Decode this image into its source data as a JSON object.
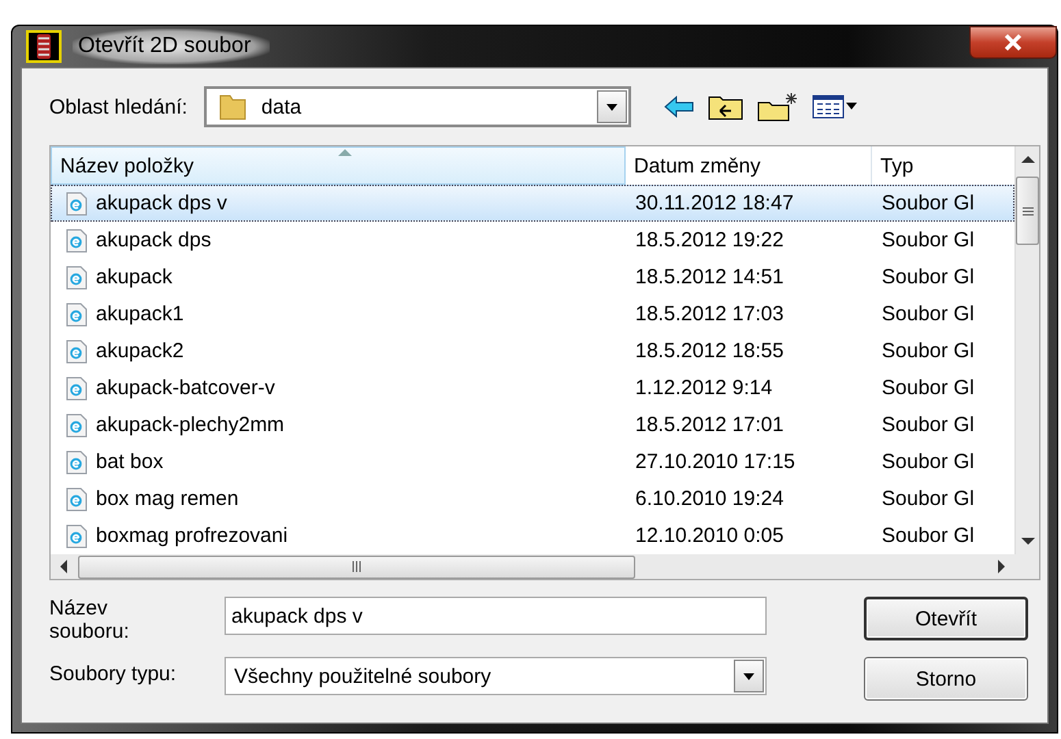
{
  "window": {
    "title": "Otevřít 2D soubor"
  },
  "look_in": {
    "label": "Oblast hledání:",
    "value": "data"
  },
  "table": {
    "columns": [
      {
        "label": "Název položky",
        "sorted": true
      },
      {
        "label": "Datum změny",
        "sorted": false
      },
      {
        "label": "Typ",
        "sorted": false
      }
    ],
    "rows": [
      {
        "name": "akupack dps v",
        "date": "30.11.2012 18:47",
        "type": "Soubor Gl",
        "selected": true
      },
      {
        "name": "akupack dps",
        "date": "18.5.2012 19:22",
        "type": "Soubor Gl",
        "selected": false
      },
      {
        "name": "akupack",
        "date": "18.5.2012 14:51",
        "type": "Soubor Gl",
        "selected": false
      },
      {
        "name": "akupack1",
        "date": "18.5.2012 17:03",
        "type": "Soubor Gl",
        "selected": false
      },
      {
        "name": "akupack2",
        "date": "18.5.2012 18:55",
        "type": "Soubor Gl",
        "selected": false
      },
      {
        "name": "akupack-batcover-v",
        "date": "1.12.2012 9:14",
        "type": "Soubor Gl",
        "selected": false
      },
      {
        "name": "akupack-plechy2mm",
        "date": "18.5.2012 17:01",
        "type": "Soubor Gl",
        "selected": false
      },
      {
        "name": "bat box",
        "date": "27.10.2010 17:15",
        "type": "Soubor Gl",
        "selected": false
      },
      {
        "name": "box mag remen",
        "date": "6.10.2010 19:24",
        "type": "Soubor Gl",
        "selected": false
      },
      {
        "name": "boxmag profrezovani",
        "date": "12.10.2010 0:05",
        "type": "Soubor Gl",
        "selected": false
      }
    ]
  },
  "file_name": {
    "label": "Název souboru:",
    "value": "akupack dps v"
  },
  "file_type": {
    "label": "Soubory typu:",
    "value": "Všechny použitelné soubory"
  },
  "buttons": [
    "Otevřít",
    "Storno"
  ]
}
